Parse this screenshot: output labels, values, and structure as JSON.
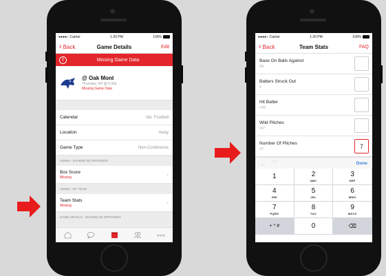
{
  "colors": {
    "accent": "#e3262b",
    "arrow": "#e81c1c",
    "link_blue": "#3a82d8"
  },
  "left_phone": {
    "status": {
      "carrier": "●●●●○ Carrier ",
      "time": "1:20 PM",
      "battery": "100%"
    },
    "nav": {
      "back": "Back",
      "title": "Game Details",
      "right": "Edit"
    },
    "alert": {
      "icon": "!",
      "text": "Missing Game Data"
    },
    "game": {
      "opponent": "@ Oak Mont",
      "date": "Thursday, 9/4 @ 5:30p",
      "missing": "Missing Game Data",
      "logo_icon": "team-logo-icon"
    },
    "details": [
      {
        "label": "Calendar",
        "value": "Var. Football"
      },
      {
        "label": "Location",
        "value": "Away"
      },
      {
        "label": "Game Type",
        "value": "Non-Conference"
      }
    ],
    "section_shared": "ADMIN - SHARED W/ OPPONENT",
    "box_score": {
      "label": "Box Score",
      "sub": "Missing"
    },
    "section_my_team": "ADMIN - MY TEAM",
    "team_stats": {
      "label": "Team Stats",
      "sub": "Missing"
    },
    "section_game_details": "GAME DETAILS - SHARED W/ OPPONENT",
    "tabs": [
      "home-icon",
      "chat-icon",
      "calendar-icon",
      "people-icon",
      "more-icon"
    ]
  },
  "right_phone": {
    "status": {
      "carrier": "●●●●○ Carrier ",
      "time": "1:20 PM",
      "battery": "100%"
    },
    "nav": {
      "back": "Back",
      "title": "Team Stats",
      "right": "FAQ"
    },
    "stats": [
      {
        "label": "Base On Balls Against",
        "abbr": "BB",
        "value": ""
      },
      {
        "label": "Batters Struck Out",
        "abbr": "K",
        "value": ""
      },
      {
        "label": "Hit Batter",
        "abbr": "HBP",
        "value": ""
      },
      {
        "label": "Wild Pitches",
        "abbr": "WP",
        "value": ""
      },
      {
        "label": "Number Of Pitches",
        "abbr": "#P",
        "value": "7"
      }
    ],
    "keyboard": {
      "done": "Done",
      "keys": [
        {
          "n": "1",
          "l": ""
        },
        {
          "n": "2",
          "l": "ABC"
        },
        {
          "n": "3",
          "l": "DEF"
        },
        {
          "n": "4",
          "l": "GHI"
        },
        {
          "n": "5",
          "l": "JKL"
        },
        {
          "n": "6",
          "l": "MNO"
        },
        {
          "n": "7",
          "l": "PQRS"
        },
        {
          "n": "8",
          "l": "TUV"
        },
        {
          "n": "9",
          "l": "WXYZ"
        },
        {
          "n": "+ * #",
          "l": ""
        },
        {
          "n": "0",
          "l": ""
        },
        {
          "n": "⌫",
          "l": ""
        }
      ]
    }
  }
}
